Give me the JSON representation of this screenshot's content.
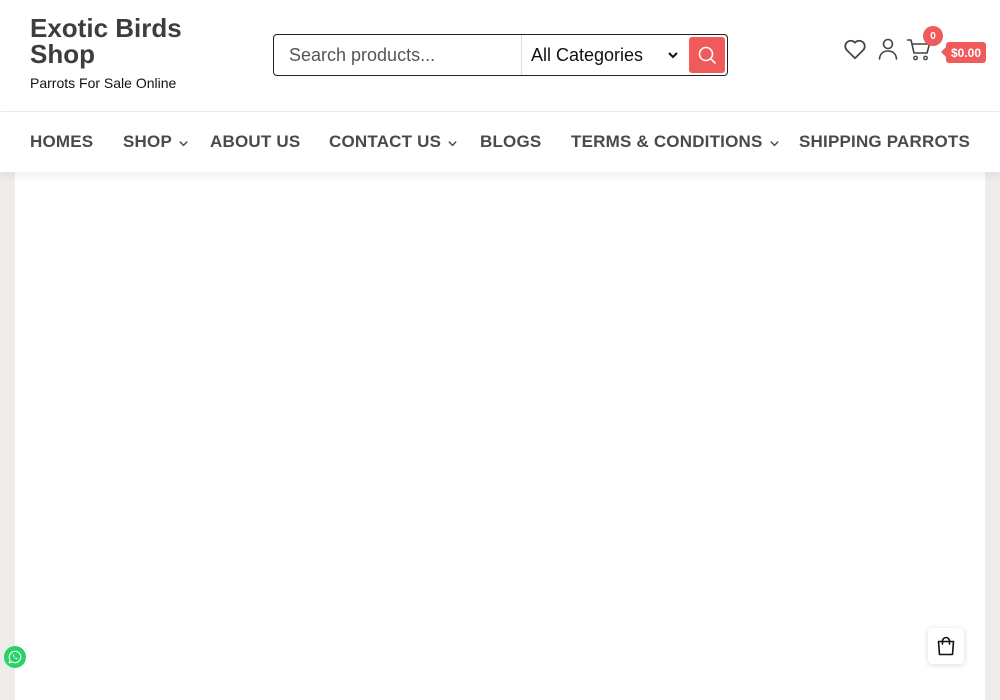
{
  "brand": {
    "title": "Exotic Birds Shop",
    "tagline": "Parrots For Sale Online"
  },
  "search": {
    "placeholder": "Search products...",
    "value": "",
    "category_selected": "All Categories",
    "button_icon": "search-icon"
  },
  "header_icons": {
    "wishlist_icon": "heart-icon",
    "account_icon": "user-icon",
    "cart_icon": "cart-icon",
    "cart_count": "0",
    "cart_total": "$0.00"
  },
  "nav": {
    "items": [
      {
        "label": "HOMES"
      },
      {
        "label": "SHOP",
        "dropdown": true
      },
      {
        "label": "ABOUT US"
      },
      {
        "label": "CONTACT US",
        "dropdown": true
      },
      {
        "label": "BLOGS"
      },
      {
        "label": "TERMS & CONDITIONS",
        "dropdown": true
      },
      {
        "label": "SHIPPING PARROTS"
      }
    ]
  },
  "floating": {
    "whatsapp_icon": "whatsapp-icon",
    "cart_icon": "shopping-bag-icon"
  },
  "colors": {
    "accent": "#f05a5a",
    "text": "#4a4a4a",
    "page_bg": "#efebe8",
    "whatsapp": "#25d366"
  }
}
